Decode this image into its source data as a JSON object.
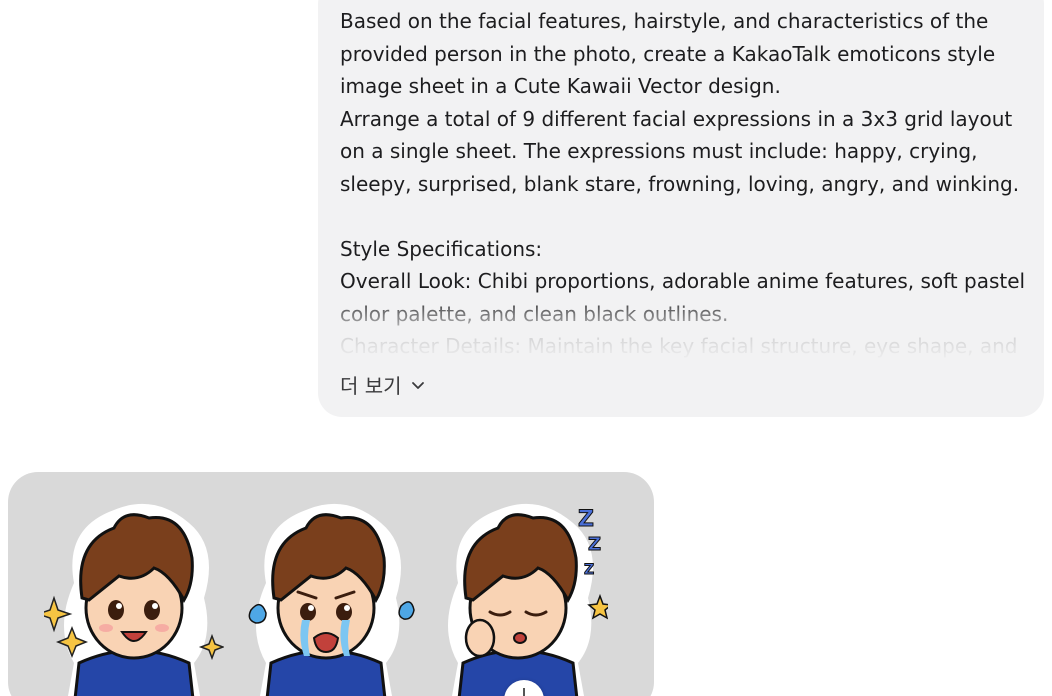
{
  "user_message": {
    "lines": [
      "Based on the facial features, hairstyle, and characteristics of the",
      "provided person in the photo, create a KakaoTalk emoticons style",
      "image sheet in a Cute Kawaii Vector design.",
      "Arrange a total of 9 different facial expressions in a 3x3 grid layout",
      "on a single sheet. The expressions must include: happy, crying,",
      "sleepy, surprised, blank stare, frowning, loving, angry, and winking.",
      "",
      "Style Specifications:",
      "Overall Look: Chibi proportions, adorable anime features, soft pastel",
      "color palette, and clean black outlines.",
      "Character Details: Maintain the key facial structure, eye shape, and"
    ],
    "show_more_label": "더 보기",
    "show_more_icon": "chevron-down-icon"
  },
  "generated_image": {
    "stickers": [
      {
        "expression": "happy",
        "icon": "happy-sticker"
      },
      {
        "expression": "crying",
        "icon": "crying-sticker"
      },
      {
        "expression": "sleepy",
        "icon": "sleepy-sticker",
        "zzz": "Zzz"
      }
    ]
  },
  "colors": {
    "bubble_bg": "#f2f2f3",
    "image_bg": "#d9d9d9",
    "hair": "#7a3f1c",
    "skin": "#f9d3b4",
    "hoodie": "#2546a8"
  }
}
